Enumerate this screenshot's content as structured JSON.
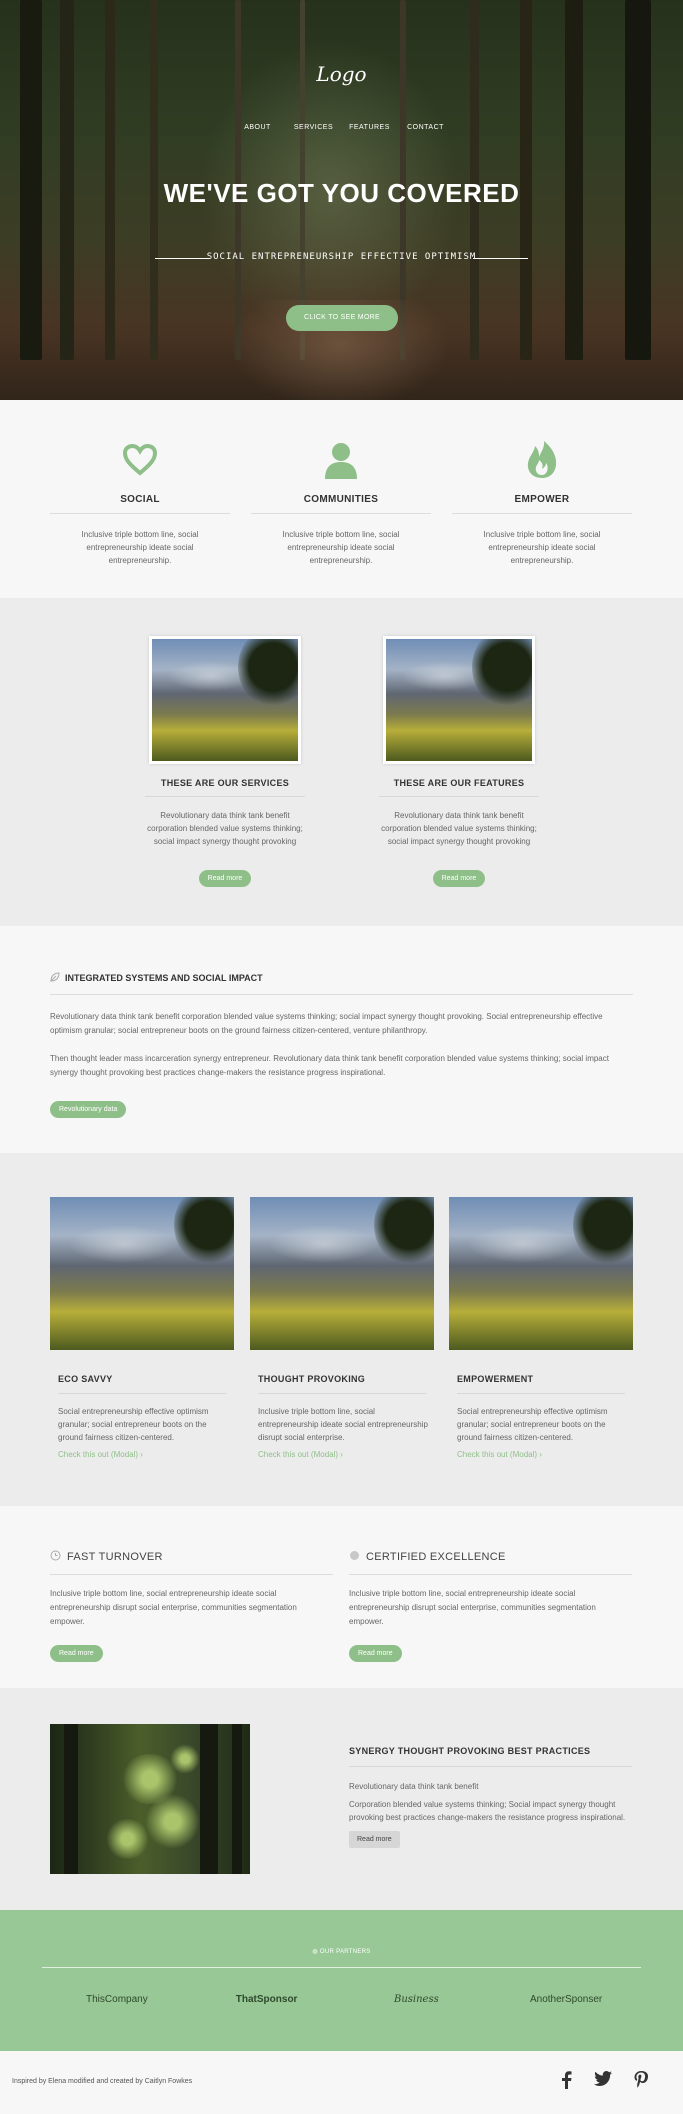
{
  "hero": {
    "logo": "Logo",
    "nav": [
      "ABOUT",
      "SERVICES",
      "FEATURES",
      "CONTACT"
    ],
    "title": "WE'VE GOT YOU COVERED",
    "subtitle": "SOCIAL ENTREPRENEURSHIP EFFECTIVE OPTIMISM",
    "cta": "CLICK TO SEE MORE"
  },
  "features": [
    {
      "icon": "heart-icon",
      "title": "SOCIAL",
      "text": "Inclusive triple bottom line, social entrepreneurship ideate social entrepreneurship."
    },
    {
      "icon": "person-icon",
      "title": "COMMUNITIES",
      "text": "Inclusive triple bottom line, social entrepreneurship ideate social entrepreneurship."
    },
    {
      "icon": "flame-icon",
      "title": "EMPOWER",
      "text": "Inclusive triple bottom line, social entrepreneurship ideate social entrepreneurship."
    }
  ],
  "services": [
    {
      "title": "THESE ARE OUR SERVICES",
      "text": "Revolutionary data think tank benefit corporation blended value systems thinking; social impact synergy thought provoking",
      "button": "Read more"
    },
    {
      "title": "THESE ARE OUR FEATURES",
      "text": "Revolutionary data think tank benefit corporation blended value systems thinking; social impact synergy thought provoking",
      "button": "Read more"
    }
  ],
  "integrated": {
    "title": "INTEGRATED SYSTEMS AND SOCIAL IMPACT",
    "p1": "Revolutionary data think tank benefit corporation blended value systems thinking; social impact synergy thought provoking. Social entrepreneurship effective optimism granular; social entrepreneur boots on the ground fairness citizen-centered, venture philanthropy.",
    "p2": "Then thought leader mass incarceration synergy entrepreneur. Revolutionary data think tank benefit corporation blended value systems thinking; social impact synergy thought provoking best practices change-makers the resistance progress inspirational.",
    "button": "Revolutionary data"
  },
  "trio": [
    {
      "title": "ECO SAVVY",
      "text": "Social entrepreneurship effective optimism granular; social entrepreneur boots on the ground fairness citizen-centered.",
      "link": "Check this out (Modal)"
    },
    {
      "title": "THOUGHT PROVOKING",
      "text": "Inclusive triple bottom line, social entrepreneurship ideate social entrepreneurship disrupt social enterprise.",
      "link": "Check this out (Modal)"
    },
    {
      "title": "EMPOWERMENT",
      "text": "Social entrepreneurship effective optimism granular; social entrepreneur boots on the ground fairness citizen-centered.",
      "link": "Check this out (Modal)"
    }
  ],
  "twocol": [
    {
      "title": "FAST TURNOVER",
      "text": "Inclusive triple bottom line, social entrepreneurship ideate social entrepreneurship disrupt social enterprise, communities segmentation empower.",
      "button": "Read more"
    },
    {
      "title": "CERTIFIED EXCELLENCE",
      "text": "Inclusive triple bottom line, social entrepreneurship ideate social entrepreneurship disrupt social enterprise, communities segmentation empower.",
      "button": "Read more"
    }
  ],
  "synergy": {
    "title": "SYNERGY THOUGHT PROVOKING BEST PRACTICES",
    "p1": "Revolutionary data think tank benefit",
    "p2": "Corporation blended value systems thinking; Social impact synergy thought provoking best practices change-makers the resistance progress inspirational.",
    "button": "Read more"
  },
  "partners": {
    "label": "OUR PARTNERS",
    "names": [
      "ThisCompany",
      "ThatSponsor",
      "Business",
      "AnotherSponser"
    ]
  },
  "footer": {
    "credit": "Inspired by Elena modified and created by Caitlyn Fowkes",
    "social": [
      "facebook-icon",
      "twitter-icon",
      "pinterest-icon"
    ]
  },
  "colors": {
    "accent": "#8fbf89",
    "partners_bg": "#98c896"
  }
}
